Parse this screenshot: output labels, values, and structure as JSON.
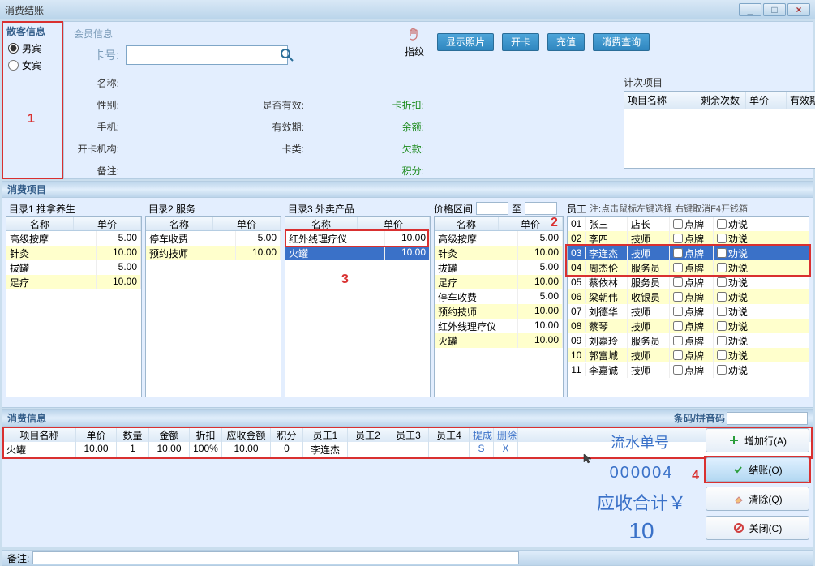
{
  "window": {
    "title": "消费结账",
    "min": "_",
    "max": "□",
    "close": "×"
  },
  "guest": {
    "header": "散客信息",
    "male": "男宾",
    "female": "女宾",
    "annot1": "1"
  },
  "member": {
    "tab": "会员信息",
    "card_label": "卡号:",
    "name_label": "名称:",
    "gender_label": "性别:",
    "phone_label": "手机:",
    "org_label": "开卡机构:",
    "remark_label": "备注:",
    "valid_label": "是否有效:",
    "expire_label": "有效期:",
    "cardtype_label": "卡类:",
    "discount_label": "卡折扣:",
    "balance_label": "余额:",
    "debt_label": "欠款:",
    "points_label": "积分:",
    "fingerprint": "指纹",
    "btn_photo": "显示照片",
    "btn_open": "开卡",
    "btn_recharge": "充值",
    "btn_query": "消费查询",
    "count_title": "计次项目",
    "count_cols": {
      "name": "项目名称",
      "remain": "剩余次数",
      "price": "单价",
      "expire": "有效期至"
    }
  },
  "consume": {
    "header": "消费项目",
    "cat1": "目录1 推拿养生",
    "cat2": "目录2 服务",
    "cat3": "目录3 外卖产品",
    "price_range": "价格区间",
    "to": "至",
    "emp_label": "员工",
    "emp_hint": "注:点击鼠标左键选择 右键取消F4开钱箱",
    "col_name": "名称",
    "col_price": "单价",
    "col_dianpai": "点牌",
    "col_quanshuo": "劝说",
    "annot2": "2",
    "annot3": "3",
    "cat1_items": [
      {
        "name": "高级按摩",
        "price": "5.00"
      },
      {
        "name": "针灸",
        "price": "10.00"
      },
      {
        "name": "拔罐",
        "price": "5.00"
      },
      {
        "name": "足疗",
        "price": "10.00"
      }
    ],
    "cat2_items": [
      {
        "name": "停车收费",
        "price": "5.00"
      },
      {
        "name": "预约技师",
        "price": "10.00"
      }
    ],
    "cat3_items": [
      {
        "name": "红外线理疗仪",
        "price": "10.00"
      },
      {
        "name": "火罐",
        "price": "10.00"
      }
    ],
    "selected_items": [
      {
        "name": "高级按摩",
        "price": "5.00"
      },
      {
        "name": "针灸",
        "price": "10.00"
      },
      {
        "name": "拔罐",
        "price": "5.00"
      },
      {
        "name": "足疗",
        "price": "10.00"
      },
      {
        "name": "停车收费",
        "price": "5.00"
      },
      {
        "name": "预约技师",
        "price": "10.00"
      },
      {
        "name": "红外线理疗仪",
        "price": "10.00"
      },
      {
        "name": "火罐",
        "price": "10.00"
      }
    ],
    "employees": [
      {
        "id": "01",
        "name": "张三",
        "role": "店长"
      },
      {
        "id": "02",
        "name": "李四",
        "role": "技师"
      },
      {
        "id": "03",
        "name": "李连杰",
        "role": "技师"
      },
      {
        "id": "04",
        "name": "周杰伦",
        "role": "服务员"
      },
      {
        "id": "05",
        "name": "蔡依林",
        "role": "服务员"
      },
      {
        "id": "06",
        "name": "梁朝伟",
        "role": "收银员"
      },
      {
        "id": "07",
        "name": "刘德华",
        "role": "技师"
      },
      {
        "id": "08",
        "name": "蔡琴",
        "role": "技师"
      },
      {
        "id": "09",
        "name": "刘嘉玲",
        "role": "服务员"
      },
      {
        "id": "10",
        "name": "郭富城",
        "role": "技师"
      },
      {
        "id": "11",
        "name": "李嘉诚",
        "role": "技师"
      }
    ],
    "emp_selected_id": "03"
  },
  "info": {
    "header": "消费信息",
    "barcode_label": "条码/拼音码",
    "cols": {
      "name": "项目名称",
      "price": "单价",
      "qty": "数量",
      "amt": "金额",
      "disc": "折扣",
      "pay": "应收金额",
      "pt": "积分",
      "e1": "员工1",
      "e2": "员工2",
      "e3": "员工3",
      "e4": "员工4",
      "up": "提成",
      "del": "删除"
    },
    "rows": [
      {
        "name": "火罐",
        "price": "10.00",
        "qty": "1",
        "amt": "10.00",
        "disc": "100%",
        "pay": "10.00",
        "pt": "0",
        "e1": "李连杰",
        "e2": "",
        "e3": "",
        "e4": "",
        "up": "S",
        "del": "X"
      }
    ],
    "flow_label": "流水单号",
    "flow_num": "000004",
    "total_label": "应收合计￥",
    "total_num": "10",
    "annot4": "4",
    "btn_add": "增加行(A)",
    "btn_checkout": "结账(O)",
    "btn_clear": "清除(Q)",
    "btn_close": "关闭(C)"
  },
  "remark": {
    "label": "备注:"
  }
}
